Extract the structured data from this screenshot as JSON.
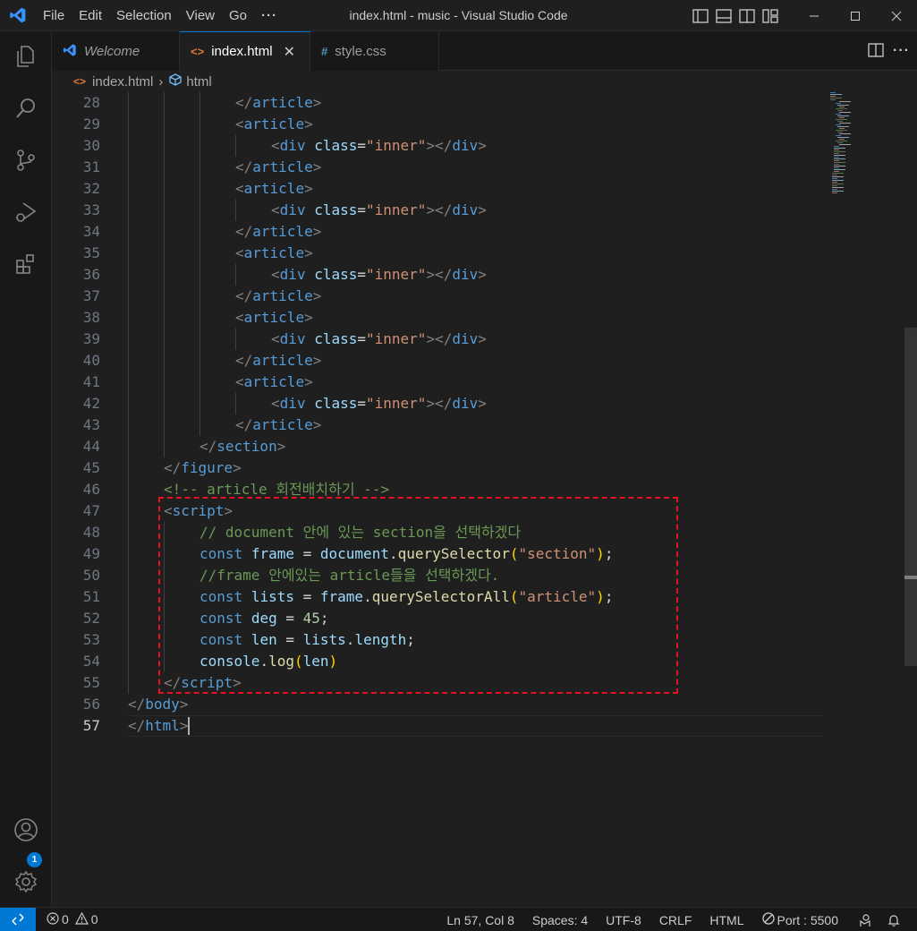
{
  "window": {
    "title": "index.html - music - Visual Studio Code",
    "menu": [
      "File",
      "Edit",
      "Selection",
      "View",
      "Go",
      "···"
    ]
  },
  "tabs": [
    {
      "label": "Welcome",
      "icon": "vscode-logo-icon",
      "active": false
    },
    {
      "label": "index.html",
      "icon": "html-file-icon",
      "active": true
    },
    {
      "label": "style.css",
      "icon": "css-file-icon",
      "active": false
    }
  ],
  "breadcrumb": {
    "file": "index.html",
    "symbol": "html"
  },
  "editor": {
    "current_line": 57,
    "lines": [
      {
        "n": "28",
        "i": 3,
        "t": [
          [
            "tag",
            "</"
          ],
          [
            "name",
            "article"
          ],
          [
            "tag",
            ">"
          ]
        ]
      },
      {
        "n": "29",
        "i": 3,
        "t": [
          [
            "tag",
            "<"
          ],
          [
            "name",
            "article"
          ],
          [
            "tag",
            ">"
          ]
        ]
      },
      {
        "n": "30",
        "i": 4,
        "t": [
          [
            "tag",
            "<"
          ],
          [
            "name",
            "div"
          ],
          [
            "pl",
            " "
          ],
          [
            "attr",
            "class"
          ],
          [
            "pl",
            "="
          ],
          [
            "str",
            "\"inner\""
          ],
          [
            "tag",
            "></"
          ],
          [
            "name",
            "div"
          ],
          [
            "tag",
            ">"
          ]
        ]
      },
      {
        "n": "31",
        "i": 3,
        "t": [
          [
            "tag",
            "</"
          ],
          [
            "name",
            "article"
          ],
          [
            "tag",
            ">"
          ]
        ]
      },
      {
        "n": "32",
        "i": 3,
        "t": [
          [
            "tag",
            "<"
          ],
          [
            "name",
            "article"
          ],
          [
            "tag",
            ">"
          ]
        ]
      },
      {
        "n": "33",
        "i": 4,
        "t": [
          [
            "tag",
            "<"
          ],
          [
            "name",
            "div"
          ],
          [
            "pl",
            " "
          ],
          [
            "attr",
            "class"
          ],
          [
            "pl",
            "="
          ],
          [
            "str",
            "\"inner\""
          ],
          [
            "tag",
            "></"
          ],
          [
            "name",
            "div"
          ],
          [
            "tag",
            ">"
          ]
        ]
      },
      {
        "n": "34",
        "i": 3,
        "t": [
          [
            "tag",
            "</"
          ],
          [
            "name",
            "article"
          ],
          [
            "tag",
            ">"
          ]
        ]
      },
      {
        "n": "35",
        "i": 3,
        "t": [
          [
            "tag",
            "<"
          ],
          [
            "name",
            "article"
          ],
          [
            "tag",
            ">"
          ]
        ]
      },
      {
        "n": "36",
        "i": 4,
        "t": [
          [
            "tag",
            "<"
          ],
          [
            "name",
            "div"
          ],
          [
            "pl",
            " "
          ],
          [
            "attr",
            "class"
          ],
          [
            "pl",
            "="
          ],
          [
            "str",
            "\"inner\""
          ],
          [
            "tag",
            "></"
          ],
          [
            "name",
            "div"
          ],
          [
            "tag",
            ">"
          ]
        ]
      },
      {
        "n": "37",
        "i": 3,
        "t": [
          [
            "tag",
            "</"
          ],
          [
            "name",
            "article"
          ],
          [
            "tag",
            ">"
          ]
        ]
      },
      {
        "n": "38",
        "i": 3,
        "t": [
          [
            "tag",
            "<"
          ],
          [
            "name",
            "article"
          ],
          [
            "tag",
            ">"
          ]
        ]
      },
      {
        "n": "39",
        "i": 4,
        "t": [
          [
            "tag",
            "<"
          ],
          [
            "name",
            "div"
          ],
          [
            "pl",
            " "
          ],
          [
            "attr",
            "class"
          ],
          [
            "pl",
            "="
          ],
          [
            "str",
            "\"inner\""
          ],
          [
            "tag",
            "></"
          ],
          [
            "name",
            "div"
          ],
          [
            "tag",
            ">"
          ]
        ]
      },
      {
        "n": "40",
        "i": 3,
        "t": [
          [
            "tag",
            "</"
          ],
          [
            "name",
            "article"
          ],
          [
            "tag",
            ">"
          ]
        ]
      },
      {
        "n": "41",
        "i": 3,
        "t": [
          [
            "tag",
            "<"
          ],
          [
            "name",
            "article"
          ],
          [
            "tag",
            ">"
          ]
        ]
      },
      {
        "n": "42",
        "i": 4,
        "t": [
          [
            "tag",
            "<"
          ],
          [
            "name",
            "div"
          ],
          [
            "pl",
            " "
          ],
          [
            "attr",
            "class"
          ],
          [
            "pl",
            "="
          ],
          [
            "str",
            "\"inner\""
          ],
          [
            "tag",
            "></"
          ],
          [
            "name",
            "div"
          ],
          [
            "tag",
            ">"
          ]
        ]
      },
      {
        "n": "43",
        "i": 3,
        "t": [
          [
            "tag",
            "</"
          ],
          [
            "name",
            "article"
          ],
          [
            "tag",
            ">"
          ]
        ]
      },
      {
        "n": "44",
        "i": 2,
        "t": [
          [
            "tag",
            "</"
          ],
          [
            "name",
            "section"
          ],
          [
            "tag",
            ">"
          ]
        ]
      },
      {
        "n": "45",
        "i": 1,
        "t": [
          [
            "tag",
            "</"
          ],
          [
            "name",
            "figure"
          ],
          [
            "tag",
            ">"
          ]
        ]
      },
      {
        "n": "46",
        "i": 1,
        "t": [
          [
            "com",
            "<!-- article 회전배치하기 -->"
          ]
        ]
      },
      {
        "n": "47",
        "i": 1,
        "t": [
          [
            "tag",
            "<"
          ],
          [
            "name",
            "script"
          ],
          [
            "tag",
            ">"
          ]
        ]
      },
      {
        "n": "48",
        "i": 2,
        "t": [
          [
            "com",
            "// document 안에 있는 section을 선택하겠다"
          ]
        ]
      },
      {
        "n": "49",
        "i": 2,
        "t": [
          [
            "kw",
            "const"
          ],
          [
            "pl",
            " "
          ],
          [
            "var",
            "frame"
          ],
          [
            "pl",
            " = "
          ],
          [
            "var",
            "document"
          ],
          [
            "pl",
            "."
          ],
          [
            "fn",
            "querySelector"
          ],
          [
            "br",
            "("
          ],
          [
            "str",
            "\"section\""
          ],
          [
            "br",
            ")"
          ],
          [
            "pl",
            ";"
          ]
        ]
      },
      {
        "n": "50",
        "i": 2,
        "t": [
          [
            "com",
            "//frame 안에있는 article들을 선택하겠다."
          ]
        ]
      },
      {
        "n": "51",
        "i": 2,
        "t": [
          [
            "kw",
            "const"
          ],
          [
            "pl",
            " "
          ],
          [
            "var",
            "lists"
          ],
          [
            "pl",
            " = "
          ],
          [
            "var",
            "frame"
          ],
          [
            "pl",
            "."
          ],
          [
            "fn",
            "querySelectorAll"
          ],
          [
            "br",
            "("
          ],
          [
            "str",
            "\"article\""
          ],
          [
            "br",
            ")"
          ],
          [
            "pl",
            ";"
          ]
        ]
      },
      {
        "n": "52",
        "i": 2,
        "t": [
          [
            "kw",
            "const"
          ],
          [
            "pl",
            " "
          ],
          [
            "var",
            "deg"
          ],
          [
            "pl",
            " = "
          ],
          [
            "num",
            "45"
          ],
          [
            "pl",
            ";"
          ]
        ]
      },
      {
        "n": "53",
        "i": 2,
        "t": [
          [
            "kw",
            "const"
          ],
          [
            "pl",
            " "
          ],
          [
            "var",
            "len"
          ],
          [
            "pl",
            " = "
          ],
          [
            "var",
            "lists"
          ],
          [
            "pl",
            "."
          ],
          [
            "var",
            "length"
          ],
          [
            "pl",
            ";"
          ]
        ]
      },
      {
        "n": "54",
        "i": 2,
        "t": [
          [
            "var",
            "console"
          ],
          [
            "pl",
            "."
          ],
          [
            "fn",
            "log"
          ],
          [
            "br",
            "("
          ],
          [
            "var",
            "len"
          ],
          [
            "br",
            ")"
          ]
        ]
      },
      {
        "n": "55",
        "i": 1,
        "t": [
          [
            "tag",
            "</"
          ],
          [
            "name",
            "script"
          ],
          [
            "tag",
            ">"
          ]
        ]
      },
      {
        "n": "56",
        "i": 0,
        "t": [
          [
            "tag",
            "</"
          ],
          [
            "name",
            "body"
          ],
          [
            "tag",
            ">"
          ]
        ]
      },
      {
        "n": "57",
        "i": 0,
        "t": [
          [
            "tag",
            "</"
          ],
          [
            "name",
            "html"
          ],
          [
            "tag",
            ">"
          ]
        ]
      }
    ]
  },
  "activity": {
    "settings_badge": "1"
  },
  "status": {
    "errors": "0",
    "warnings": "0",
    "position": "Ln 57, Col 8",
    "spaces": "Spaces: 4",
    "encoding": "UTF-8",
    "eol": "CRLF",
    "language": "HTML",
    "port": "Port : 5500"
  },
  "colors": {
    "accent": "#0078d4",
    "highlight_box": "#e81123"
  }
}
